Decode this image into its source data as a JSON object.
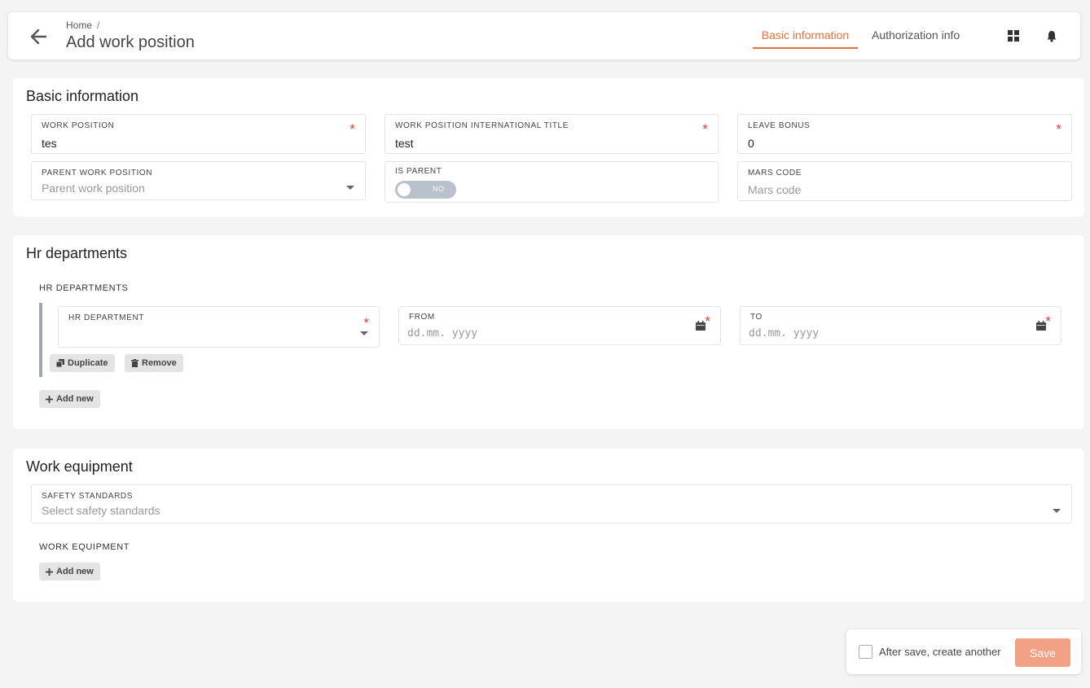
{
  "header": {
    "breadcrumb_home": "Home",
    "breadcrumb_sep": "/",
    "title": "Add work position",
    "tabs": [
      {
        "label": "Basic information",
        "active": true
      },
      {
        "label": "Authorization info",
        "active": false
      }
    ],
    "icons": [
      "back-arrow-icon",
      "grid-icon",
      "bell-icon"
    ],
    "accent_color": "#e8703a"
  },
  "basic": {
    "title": "Basic information",
    "work_position": {
      "label": "WORK POSITION",
      "value": "tes",
      "required": "*"
    },
    "intl_title": {
      "label": "WORK POSITION INTERNATIONAL TITLE",
      "value": "test",
      "required": "*"
    },
    "leave_bonus": {
      "label": "LEAVE BONUS",
      "value": "0",
      "required": "*"
    },
    "parent_position": {
      "label": "PARENT WORK POSITION",
      "placeholder": "Parent work position"
    },
    "is_parent": {
      "label": "IS PARENT",
      "toggle_text": "NO"
    },
    "mars_code": {
      "label": "MARS CODE",
      "placeholder": "Mars code"
    }
  },
  "hr": {
    "title": "Hr departments",
    "sub_label": "HR DEPARTMENTS",
    "department": {
      "label": "HR DEPARTMENT",
      "required": "*"
    },
    "from": {
      "label": "FROM",
      "placeholder": "dd.mm. yyyy",
      "required": "*"
    },
    "to": {
      "label": "TO",
      "placeholder": "dd.mm. yyyy",
      "required": "*"
    },
    "duplicate_label": "Duplicate",
    "remove_label": "Remove",
    "add_new_label": "Add new"
  },
  "equipment": {
    "title": "Work equipment",
    "safety": {
      "label": "SAFETY STANDARDS",
      "placeholder": "Select safety standards"
    },
    "sub_label": "WORK EQUIPMENT",
    "add_new_label": "Add new"
  },
  "footer": {
    "checkbox_label": "After save, create another",
    "save_label": "Save",
    "save_color": "#f2a184"
  }
}
